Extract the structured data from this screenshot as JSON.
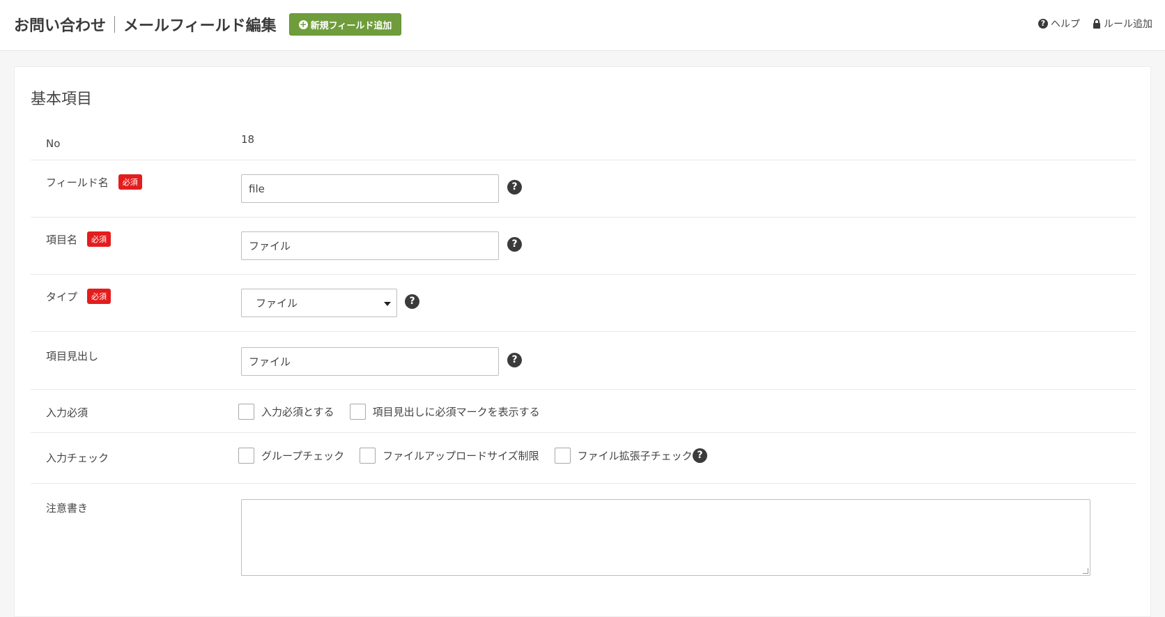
{
  "header": {
    "title_main": "お問い合わせ",
    "title_sub": "メールフィールド編集",
    "add_button": "新規フィールド追加",
    "help_link": "ヘルプ",
    "rule_link": "ルール追加"
  },
  "section": {
    "title": "基本項目"
  },
  "form": {
    "no_label": "No",
    "no_value": "18",
    "required_badge": "必須",
    "field_name_label": "フィールド名",
    "field_name_value": "file",
    "item_name_label": "項目名",
    "item_name_value": "ファイル",
    "type_label": "タイプ",
    "type_value": "ファイル",
    "heading_label": "項目見出し",
    "heading_value": "ファイル",
    "required_label": "入力必須",
    "required_options": [
      "入力必須とする",
      "項目見出しに必須マークを表示する"
    ],
    "check_label": "入力チェック",
    "check_options": [
      "グループチェック",
      "ファイルアップロードサイズ制限",
      "ファイル拡張子チェック"
    ],
    "notes_label": "注意書き"
  },
  "icons": {
    "help": "question-circle-icon",
    "lock": "lock-icon",
    "plus": "plus-circle-icon",
    "caret": "caret-down-icon"
  },
  "colors": {
    "accent_green": "#6f9d3c",
    "badge_red": "#e31d1d"
  }
}
